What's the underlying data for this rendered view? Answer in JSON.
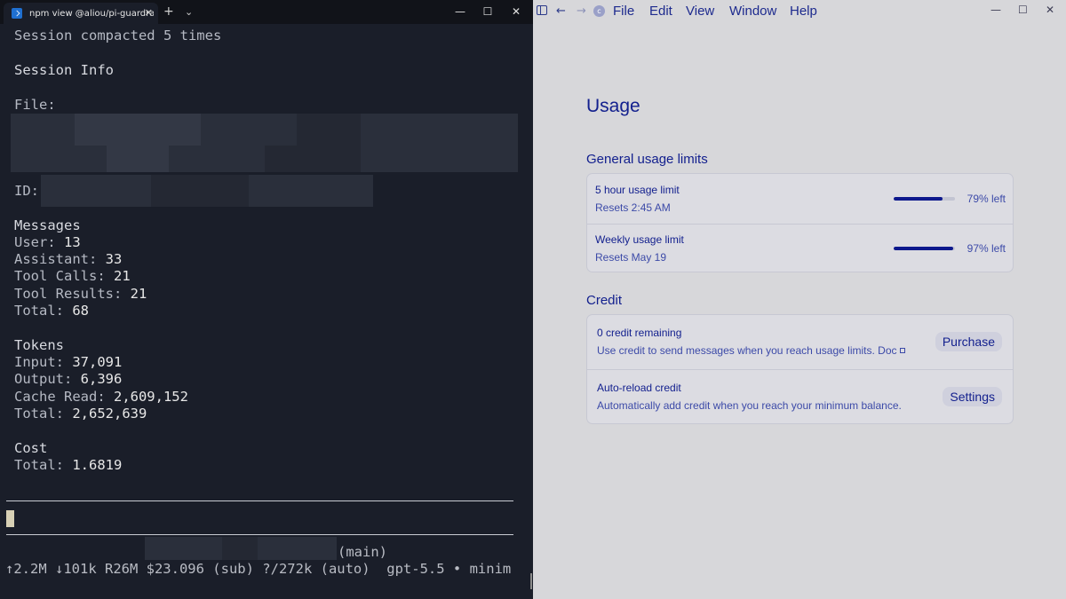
{
  "terminal": {
    "tab_title": "npm view @aliou/pi-guardrails v",
    "new_tab": "+",
    "dropdown": "⌄",
    "tab_close": "✕",
    "controls": {
      "minimize": "—",
      "maximize": "☐",
      "close": "✕"
    },
    "compact_notice": "Session compacted 5 times",
    "session_info_heading": "Session Info",
    "file_label": "File:",
    "id_label": "ID:",
    "messages": {
      "heading": "Messages",
      "user_label": "User: ",
      "user": "13",
      "assistant_label": "Assistant: ",
      "assistant": "33",
      "tool_calls_label": "Tool Calls: ",
      "tool_calls": "21",
      "tool_results_label": "Tool Results: ",
      "tool_results": "21",
      "total_label": "Total: ",
      "total": "68"
    },
    "tokens": {
      "heading": "Tokens",
      "input_label": "Input: ",
      "input": "37,091",
      "output_label": "Output: ",
      "output": "6,396",
      "cache_read_label": "Cache Read: ",
      "cache_read": "2,609,152",
      "total_label": "Total: ",
      "total": "2,652,639"
    },
    "cost": {
      "heading": "Cost",
      "total_label": "Total: ",
      "total": "1.6819"
    },
    "branch": "(main)",
    "status_line": "↑2.2M ↓101k R26M $23.096 (sub) ?/272k (auto)  gpt-5.5 • minim"
  },
  "app": {
    "menu": {
      "file": "File",
      "edit": "Edit",
      "view": "View",
      "window": "Window",
      "help": "Help"
    },
    "nav": {
      "back": "←",
      "forward": "→",
      "logo": "c"
    },
    "controls": {
      "minimize": "—",
      "maximize": "☐",
      "close": "✕"
    },
    "page_title": "Usage",
    "general": {
      "heading": "General usage limits",
      "limits": [
        {
          "title": "5 hour usage limit",
          "reset": "Resets 2:45 AM",
          "remaining": 0.79,
          "remaining_label": "79% left"
        },
        {
          "title": "Weekly usage limit",
          "reset": "Resets May 19",
          "remaining": 0.97,
          "remaining_label": "97% left"
        }
      ]
    },
    "credit": {
      "heading": "Credit",
      "remaining_title": "0 credit remaining",
      "remaining_desc": "Use credit to send messages when you reach usage limits. Doc",
      "purchase_button": "Purchase",
      "autoreload_title": "Auto-reload credit",
      "autoreload_desc": "Automatically add credit when you reach your minimum balance.",
      "settings_button": "Settings"
    },
    "colors": {
      "accent": "#13208e",
      "bar_fill": "#0d188c",
      "background": "#d7d7da"
    }
  }
}
